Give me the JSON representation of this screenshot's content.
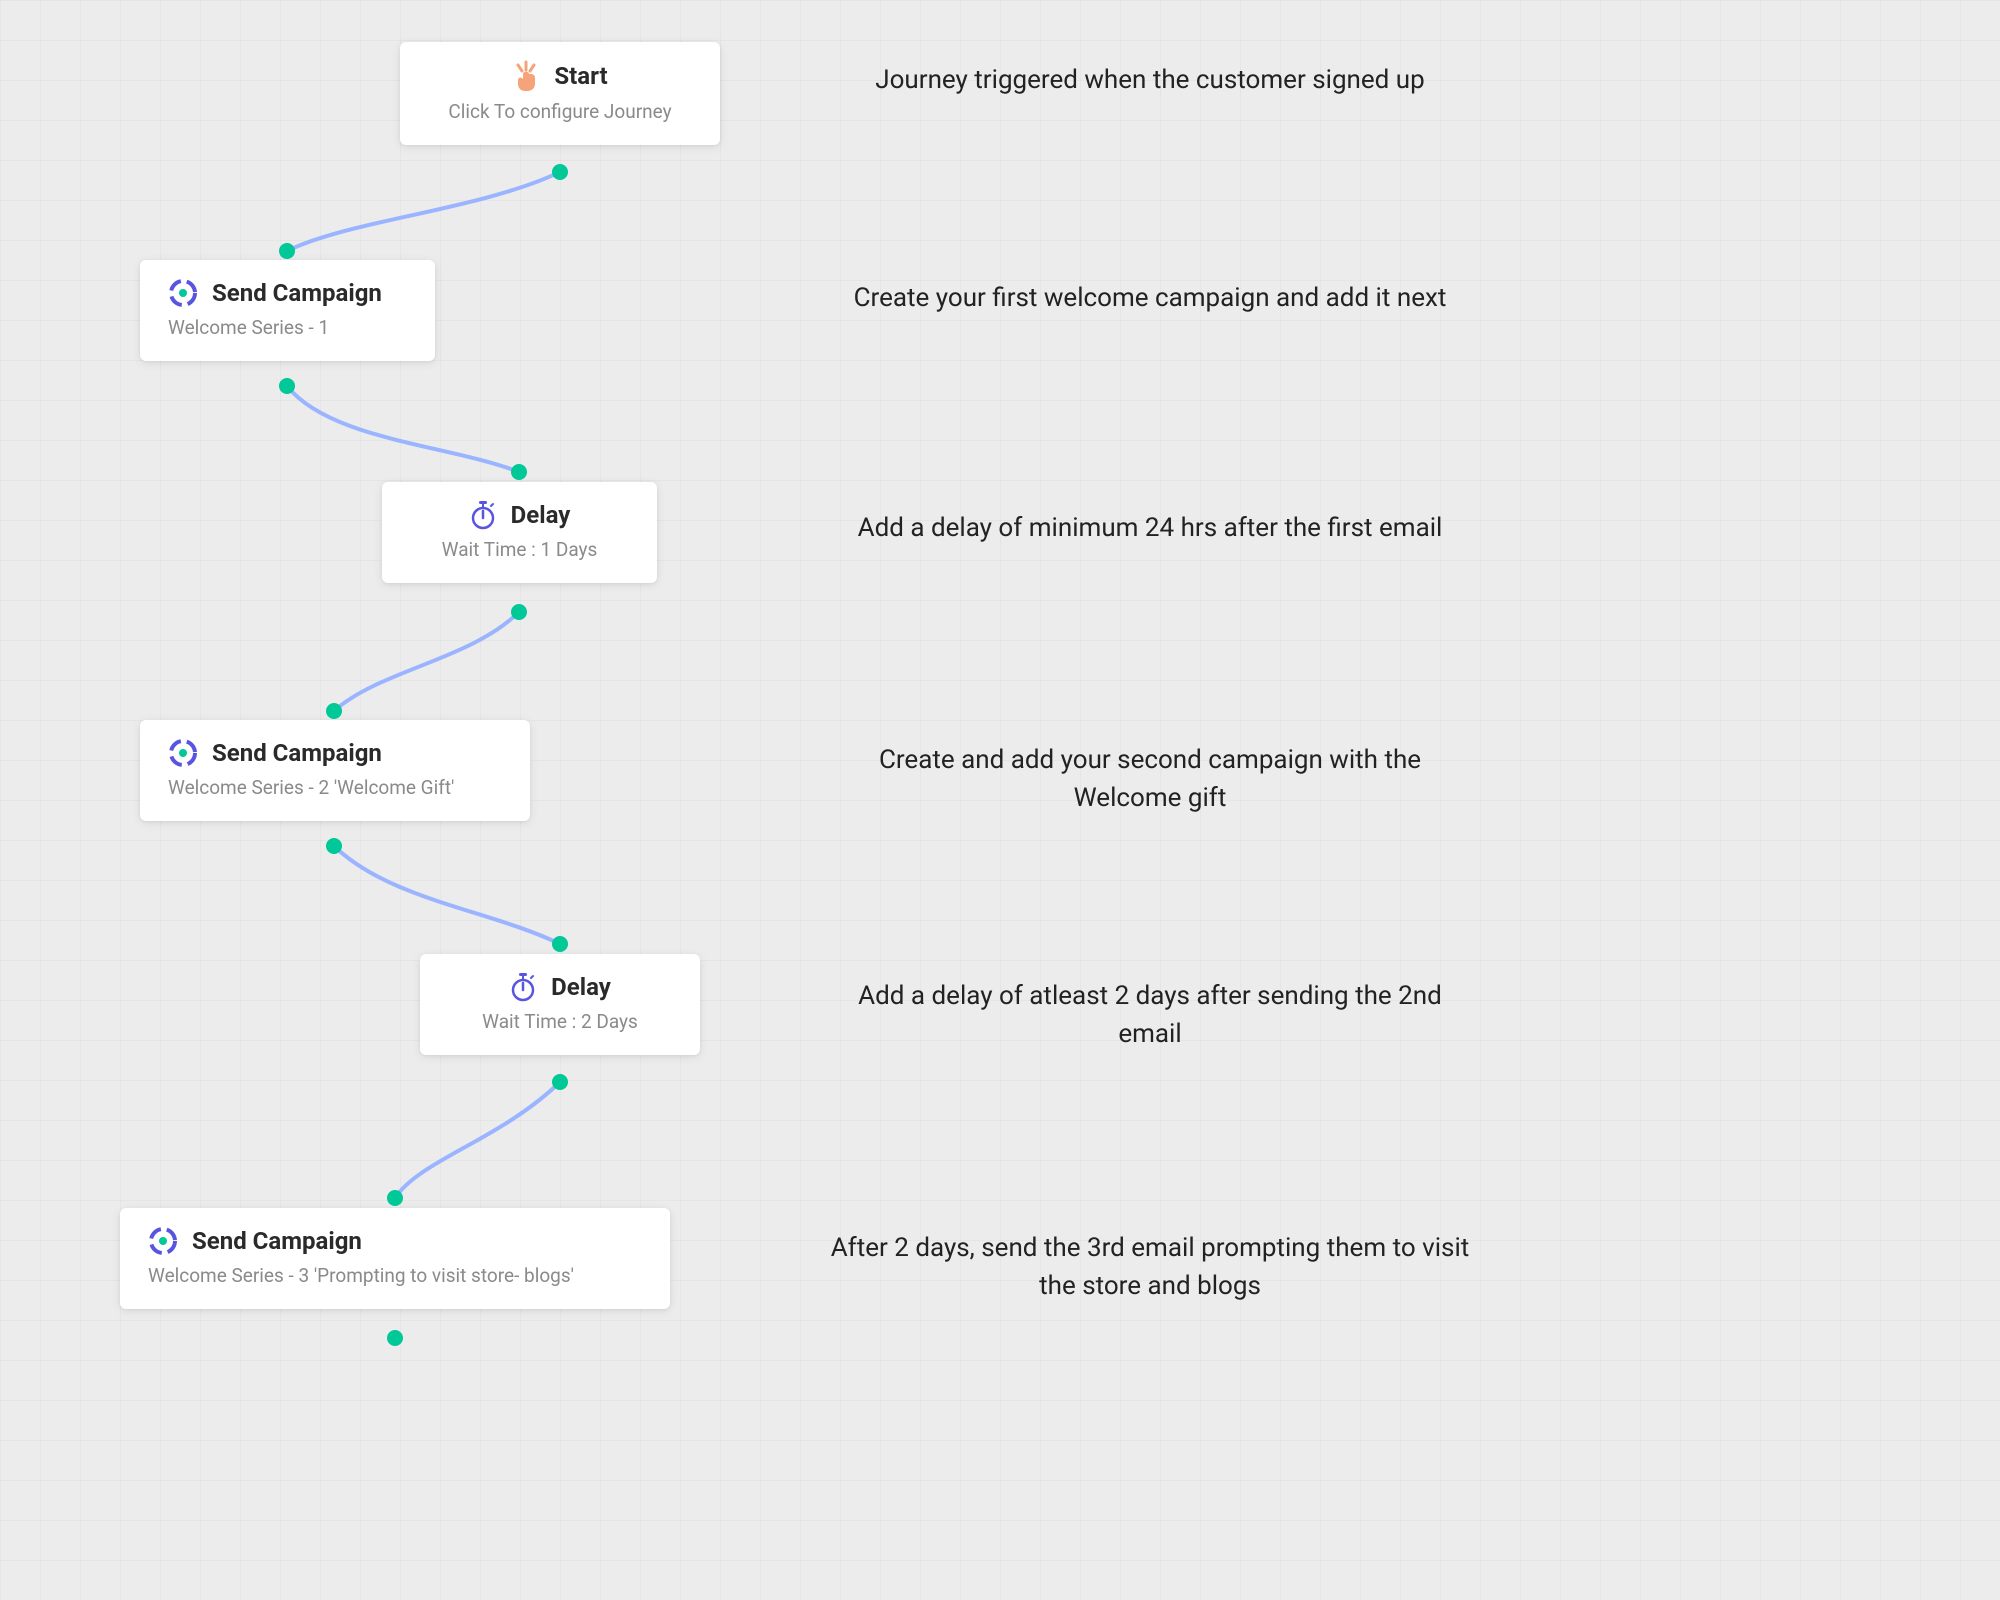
{
  "nodes": {
    "start": {
      "title": "Start",
      "subtitle": "Click To configure Journey"
    },
    "campaign1": {
      "title": "Send Campaign",
      "subtitle": "Welcome Series - 1"
    },
    "delay1": {
      "title": "Delay",
      "subtitle": "Wait Time : 1 Days"
    },
    "campaign2": {
      "title": "Send Campaign",
      "subtitle": "Welcome Series - 2 'Welcome Gift'"
    },
    "delay2": {
      "title": "Delay",
      "subtitle": "Wait Time : 2 Days"
    },
    "campaign3": {
      "title": "Send Campaign",
      "subtitle": "Welcome Series - 3 'Prompting to visit store- blogs'"
    }
  },
  "captions": {
    "c1": "Journey triggered when the customer signed up",
    "c2": "Create your first welcome campaign and add it next",
    "c3": "Add a delay of minimum 24 hrs after the first email",
    "c4": "Create and add your second campaign with the Welcome gift",
    "c5": "Add a delay of atleast 2 days after sending the 2nd email",
    "c6": "After 2 days, send the 3rd email prompting them to visit the store and blogs"
  },
  "colors": {
    "dot": "#00c896",
    "connector": "#9bb4ff",
    "iconPurple": "#5a55e0",
    "iconOrange": "#f4a37a"
  }
}
